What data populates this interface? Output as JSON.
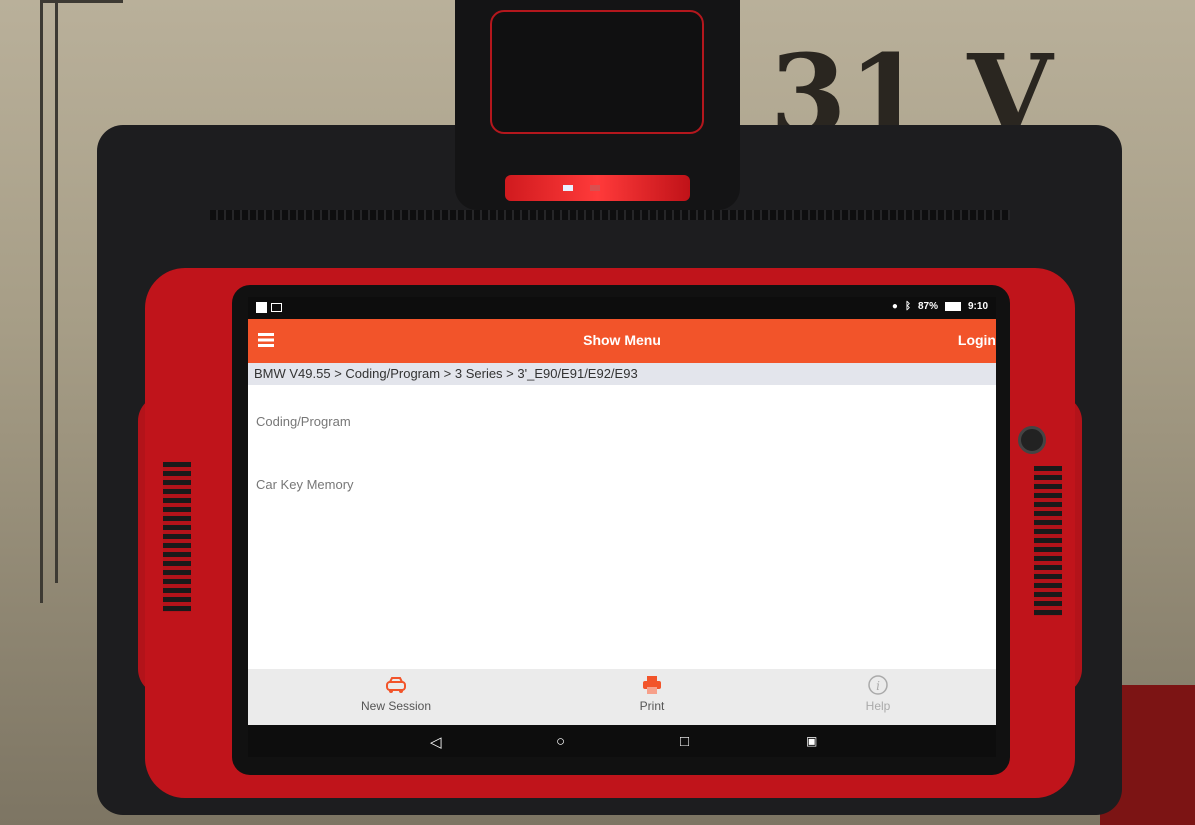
{
  "background": {
    "box_text": "31 V"
  },
  "status_bar": {
    "battery": "87%",
    "time": "9:10"
  },
  "header": {
    "title": "Show Menu",
    "login_label": "Login",
    "menu_icon": "hamburger-icon"
  },
  "breadcrumb": "BMW V49.55 > Coding/Program > 3 Series > 3'_E90/E91/E92/E93",
  "menu_items": [
    {
      "label": "Coding/Program"
    },
    {
      "label": "Car Key Memory"
    }
  ],
  "bottom_actions": [
    {
      "label": "New Session",
      "icon": "car-icon"
    },
    {
      "label": "Print",
      "icon": "printer-icon"
    },
    {
      "label": "Help",
      "icon": "info-icon"
    }
  ],
  "nav_icons": [
    "back-icon",
    "home-icon",
    "recents-icon",
    "screenshot-icon"
  ],
  "colors": {
    "accent": "#f2542a",
    "frame": "#c0141b"
  }
}
